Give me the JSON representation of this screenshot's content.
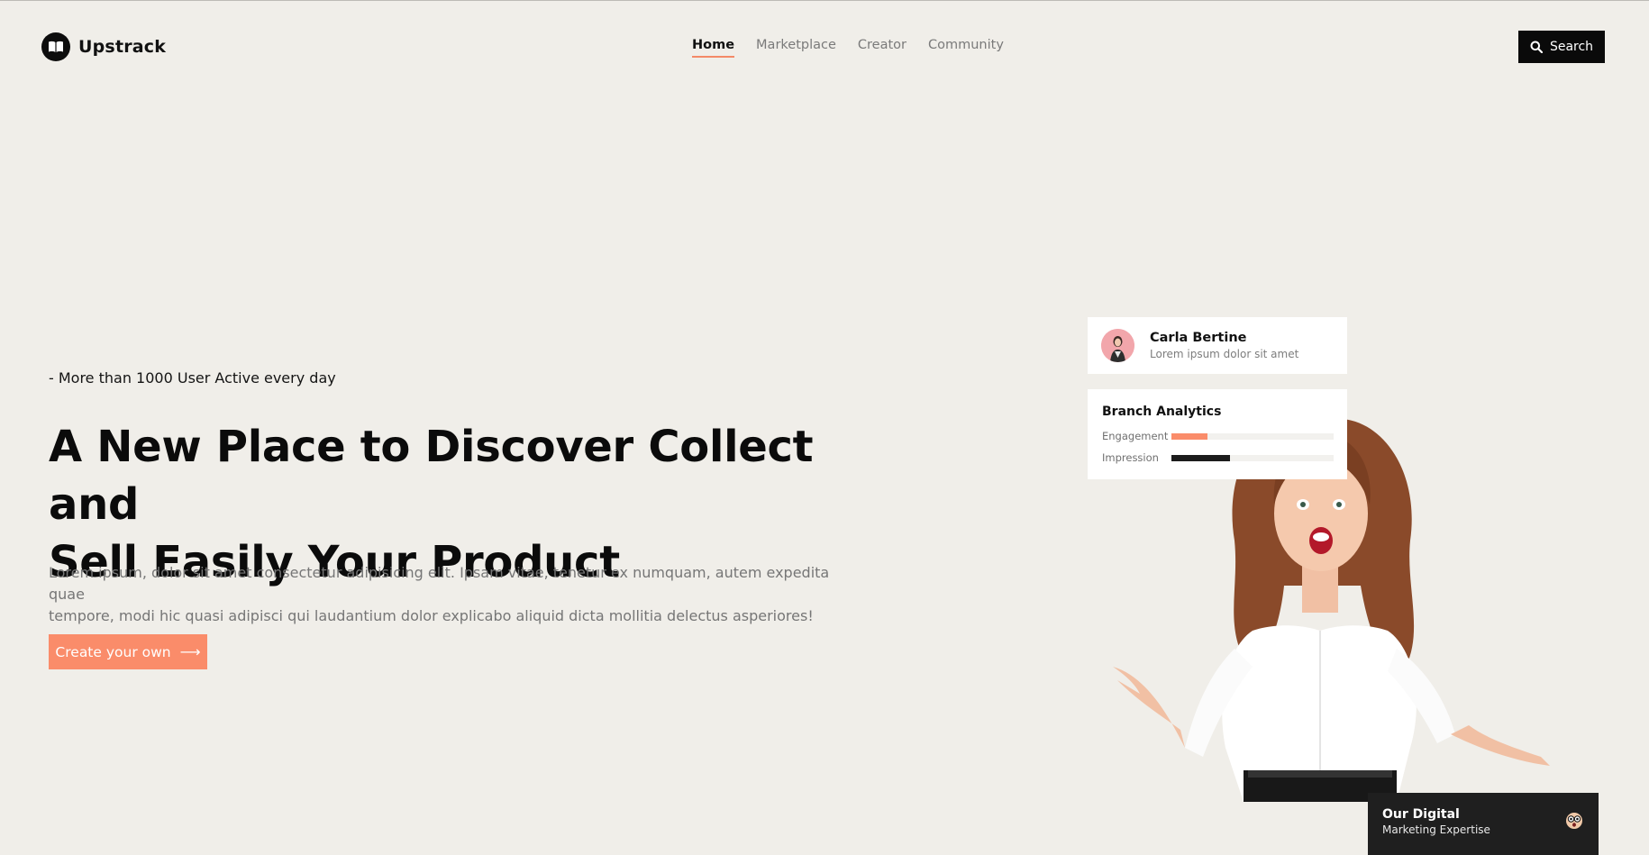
{
  "brand": {
    "name": "Upstrack",
    "icon": "book-icon"
  },
  "nav": {
    "items": [
      {
        "label": "Home",
        "active": true
      },
      {
        "label": "Marketplace",
        "active": false
      },
      {
        "label": "Creator",
        "active": false
      },
      {
        "label": "Community",
        "active": false
      }
    ]
  },
  "search": {
    "label": "Search",
    "icon": "search-icon"
  },
  "hero": {
    "tagline": "- More than 1000 User Active every day",
    "headline_line1": "A New Place to Discover Collect and",
    "headline_line2": "Sell Easily Your Product",
    "description_line1": "Lorem ipsum, dolor sit amet consectetur adipisicing elit. Ipsam vitae, tenetur ex numquam, autem expedita quae",
    "description_line2": "tempore, modi hic quasi adipisci qui laudantium dolor explicabo aliquid dicta mollitia delectus asperiores!",
    "cta_label": "Create your own",
    "cta_icon": "arrow-right-icon"
  },
  "profile_card": {
    "name": "Carla Bertine",
    "subtitle": "Lorem ipsum dolor sit amet"
  },
  "analytics": {
    "title": "Branch Analytics",
    "metrics": [
      {
        "label": "Engagement",
        "fraction": 0.22,
        "color": "#fa8c6a"
      },
      {
        "label": "Impression",
        "fraction": 0.36,
        "color": "#1c1c1c"
      }
    ]
  },
  "promo": {
    "title": "Our Digital",
    "subtitle": "Marketing Expertise",
    "icon": "emoji-face-icon"
  },
  "colors": {
    "background": "#f0eee9",
    "accent": "#fa8c6a",
    "dark": "#0a0a0a"
  }
}
